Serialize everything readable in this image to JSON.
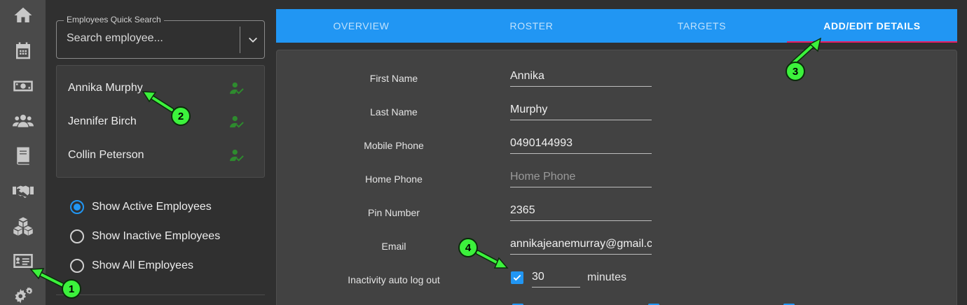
{
  "rail": {
    "items": [
      {
        "icon": "home-icon"
      },
      {
        "icon": "calendar-icon"
      },
      {
        "icon": "money-icon"
      },
      {
        "icon": "users-icon"
      },
      {
        "icon": "book-icon"
      },
      {
        "icon": "handshake-icon"
      },
      {
        "icon": "boxes-icon"
      },
      {
        "icon": "id-card-icon"
      },
      {
        "icon": "gears-icon"
      }
    ]
  },
  "search": {
    "legend": "Employees Quick Search",
    "placeholder": "Search employee..."
  },
  "employees": [
    {
      "name": "Annika Murphy"
    },
    {
      "name": "Jennifer Birch"
    },
    {
      "name": "Collin Peterson"
    }
  ],
  "filters": {
    "selected": "Show Active Employees",
    "options": [
      "Show Active Employees",
      "Show Inactive Employees",
      "Show All Employees"
    ]
  },
  "tabs": {
    "items": [
      "OVERVIEW",
      "ROSTER",
      "TARGETS",
      "ADD/EDIT DETAILS"
    ],
    "active": "ADD/EDIT DETAILS"
  },
  "form": {
    "first_name": {
      "label": "First Name",
      "value": "Annika"
    },
    "last_name": {
      "label": "Last Name",
      "value": "Murphy"
    },
    "mobile_phone": {
      "label": "Mobile Phone",
      "value": "0490144993"
    },
    "home_phone": {
      "label": "Home Phone",
      "value": "",
      "placeholder": "Home Phone"
    },
    "pin_number": {
      "label": "Pin Number",
      "value": "2365"
    },
    "email": {
      "label": "Email",
      "value": "annikajeanemurray@gmail.com"
    },
    "inactivity": {
      "label": "Inactivity auto log out",
      "checked": true,
      "minutes": "30",
      "unit": "minutes"
    }
  },
  "annotations": [
    "1",
    "2",
    "3",
    "4"
  ],
  "colors": {
    "accent": "#2196f3",
    "tab_indicator": "#e91e63",
    "marker": "#3cf23c",
    "employee_icon": "#2e8b2e"
  }
}
